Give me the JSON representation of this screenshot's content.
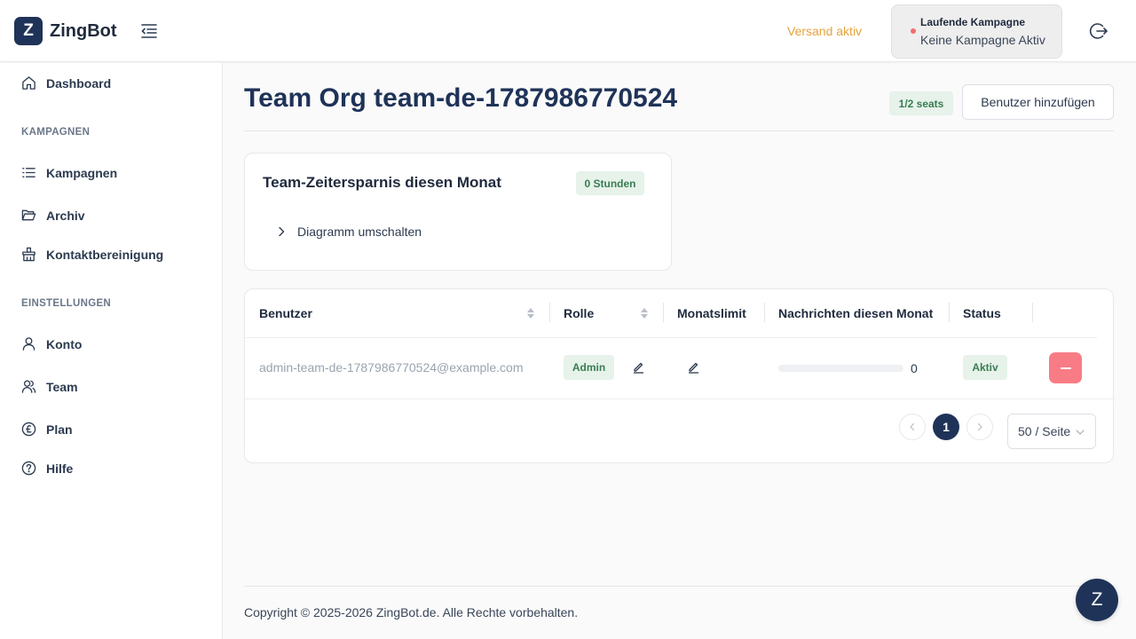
{
  "app": {
    "logo_letter": "Z",
    "name": "ZingBot"
  },
  "header": {
    "shipping_status": "Versand aktiv",
    "campaign": {
      "title": "Laufende Kampagne",
      "value": "Keine Kampagne Aktiv"
    },
    "icons": {
      "collapse": "menu-fold-icon",
      "logout": "logout-icon"
    }
  },
  "sidebar": {
    "dashboard": "Dashboard",
    "section_campaigns": "KAMPAGNEN",
    "campaigns": "Kampagnen",
    "archive": "Archiv",
    "contact_cleanup": "Kontaktbereinigung",
    "section_settings": "EINSTELLUNGEN",
    "account": "Konto",
    "team": "Team",
    "plan": "Plan",
    "help": "Hilfe"
  },
  "page": {
    "title": "Team Org team-de-1787986770524",
    "seats": "1/2 seats",
    "add_user_button": "Benutzer hinzufügen"
  },
  "savings": {
    "title": "Team-Zeitersparnis diesen Monat",
    "hours": "0 Stunden",
    "toggle_chart": "Diagramm umschalten"
  },
  "table": {
    "columns": {
      "user": "Benutzer",
      "role": "Rolle",
      "monthly_limit": "Monatslimit",
      "messages": "Nachrichten diesen Monat",
      "status": "Status"
    },
    "rows": [
      {
        "email": "admin-team-de-1787986770524@example.com",
        "role": "Admin",
        "messages_fraction": 0,
        "messages_value": "0",
        "status": "Aktiv"
      }
    ]
  },
  "pagination": {
    "current_page": "1",
    "page_size": "50 / Seite"
  },
  "footer": {
    "copyright": "Copyright © 2025-2026 ZingBot.de. Alle Rechte vorbehalten."
  },
  "chat_widget": {
    "letter": "Z"
  },
  "colors": {
    "brand": "#1f3358",
    "accent_warning": "#e6a23c",
    "danger": "#f87c85",
    "success_bg": "#e6f2ea",
    "success_text": "#3a7d52",
    "status_dot": "#f56c6c"
  }
}
